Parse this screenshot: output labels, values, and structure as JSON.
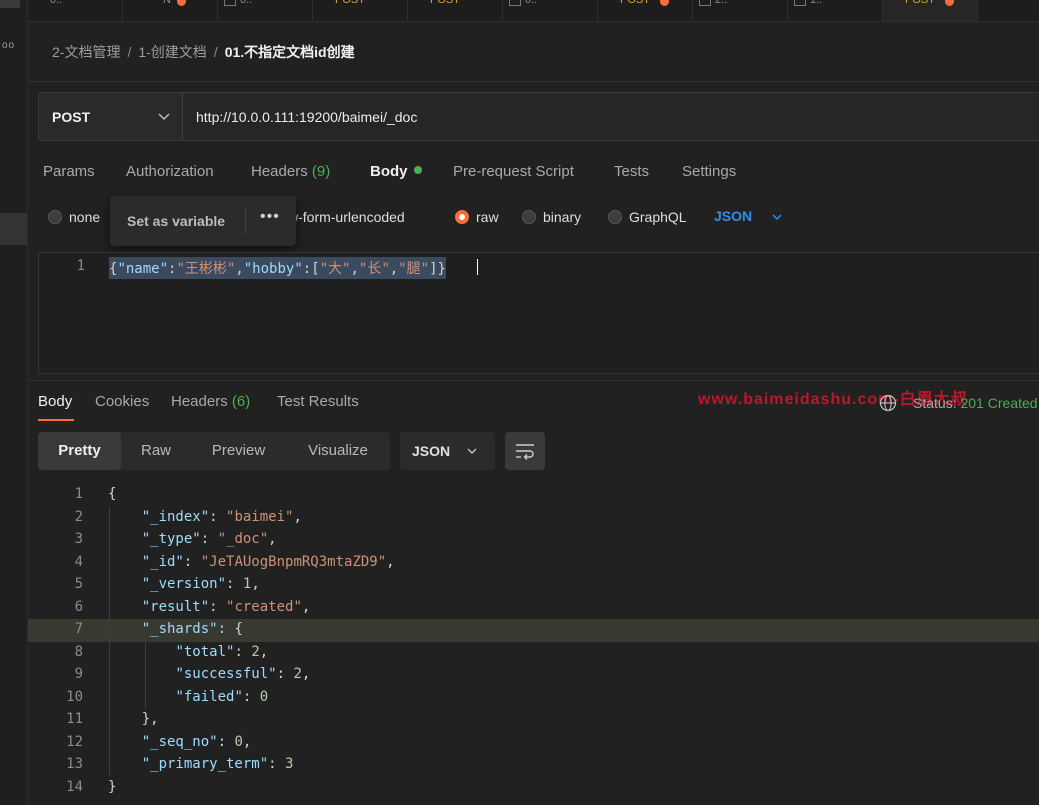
{
  "tabs": [
    {
      "label": "0..",
      "check": false,
      "dot": false
    },
    {
      "label": "N",
      "check": false,
      "dot": true
    },
    {
      "label": "0..",
      "check": true,
      "dot": false
    },
    {
      "label": "POST",
      "check": false,
      "dot": false
    },
    {
      "label": "POST",
      "check": false,
      "dot": false
    },
    {
      "label": "0..",
      "check": true,
      "dot": false
    },
    {
      "label": "POST",
      "check": false,
      "dot": true
    },
    {
      "label": "2..",
      "check": true,
      "dot": false
    },
    {
      "label": "1..",
      "check": true,
      "dot": false
    },
    {
      "label": "POST",
      "check": false,
      "dot": true
    }
  ],
  "breadcrumb": {
    "part1": "2-文档管理",
    "part2": "1-创建文档",
    "current": "01.不指定文档id创建",
    "separator": "/"
  },
  "request": {
    "method": "POST",
    "url": "http://10.0.0.111:19200/baimei/_doc"
  },
  "request_tabs": {
    "params": "Params",
    "authorization": "Authorization",
    "headers": "Headers",
    "headers_count": "(9)",
    "body": "Body",
    "pre_request": "Pre-request Script",
    "tests": "Tests",
    "settings": "Settings"
  },
  "body_types": {
    "none": "none",
    "urlencoded": "w-form-urlencoded",
    "raw": "raw",
    "binary": "binary",
    "graphql": "GraphQL",
    "format": "JSON"
  },
  "popup": {
    "label": "Set as variable",
    "more": "•••"
  },
  "request_body": {
    "line_number": "1",
    "p1": "{",
    "k1": "\"name\"",
    "c1": ":",
    "v1": "\"王彬彬\"",
    "c2": ",",
    "k2": "\"hobby\"",
    "c3": ":[",
    "v2": "\"大\"",
    "c4": ",",
    "v3": "\"长\"",
    "c5": ",",
    "v4": "\"腿\"",
    "p2": "]}"
  },
  "response_tabs": {
    "body": "Body",
    "cookies": "Cookies",
    "headers": "Headers",
    "headers_count": "(6)",
    "test_results": "Test Results"
  },
  "watermark": "www.baimeidashu.com-白眉大叔",
  "status": {
    "label": "Status:",
    "value": "201 Created"
  },
  "view_modes": {
    "pretty": "Pretty",
    "raw": "Raw",
    "preview": "Preview",
    "visualize": "Visualize"
  },
  "response_format": "JSON",
  "response_lines": [
    {
      "n": "1",
      "indent": "",
      "key": "",
      "sep": "",
      "value": "",
      "vtype": "",
      "tail": "{"
    },
    {
      "n": "2",
      "indent": "    ",
      "key": "\"_index\"",
      "sep": ": ",
      "value": "\"baimei\"",
      "vtype": "str",
      "tail": ","
    },
    {
      "n": "3",
      "indent": "    ",
      "key": "\"_type\"",
      "sep": ": ",
      "value": "\"_doc\"",
      "vtype": "str",
      "tail": ","
    },
    {
      "n": "4",
      "indent": "    ",
      "key": "\"_id\"",
      "sep": ": ",
      "value": "\"JeTAUogBnpmRQ3mtaZD9\"",
      "vtype": "str",
      "tail": ","
    },
    {
      "n": "5",
      "indent": "    ",
      "key": "\"_version\"",
      "sep": ": ",
      "value": "1",
      "vtype": "num",
      "tail": ","
    },
    {
      "n": "6",
      "indent": "    ",
      "key": "\"result\"",
      "sep": ": ",
      "value": "\"created\"",
      "vtype": "str",
      "tail": ","
    },
    {
      "n": "7",
      "indent": "    ",
      "key": "\"_shards\"",
      "sep": ": ",
      "value": "",
      "vtype": "",
      "tail": "{"
    },
    {
      "n": "8",
      "indent": "        ",
      "key": "\"total\"",
      "sep": ": ",
      "value": "2",
      "vtype": "num",
      "tail": ","
    },
    {
      "n": "9",
      "indent": "        ",
      "key": "\"successful\"",
      "sep": ": ",
      "value": "2",
      "vtype": "num",
      "tail": ","
    },
    {
      "n": "10",
      "indent": "        ",
      "key": "\"failed\"",
      "sep": ": ",
      "value": "0",
      "vtype": "num",
      "tail": ""
    },
    {
      "n": "11",
      "indent": "    ",
      "key": "",
      "sep": "",
      "value": "",
      "vtype": "",
      "tail": "},"
    },
    {
      "n": "12",
      "indent": "    ",
      "key": "\"_seq_no\"",
      "sep": ": ",
      "value": "0",
      "vtype": "num",
      "tail": ","
    },
    {
      "n": "13",
      "indent": "    ",
      "key": "\"_primary_term\"",
      "sep": ": ",
      "value": "3",
      "vtype": "num",
      "tail": ""
    },
    {
      "n": "14",
      "indent": "",
      "key": "",
      "sep": "",
      "value": "",
      "vtype": "",
      "tail": "}"
    }
  ],
  "highlighted_line": "7",
  "icons": {
    "method_chevron": "chevron-down-icon",
    "format_chevron": "chevron-down-icon",
    "globe": "globe-icon",
    "wrap": "wrap-lines-icon",
    "sidebar_more": "more-dots-icon"
  },
  "colors": {
    "accent": "#ff6c37",
    "link": "#2f8eed",
    "success": "#4caf50",
    "watermark": "#c0162b"
  }
}
